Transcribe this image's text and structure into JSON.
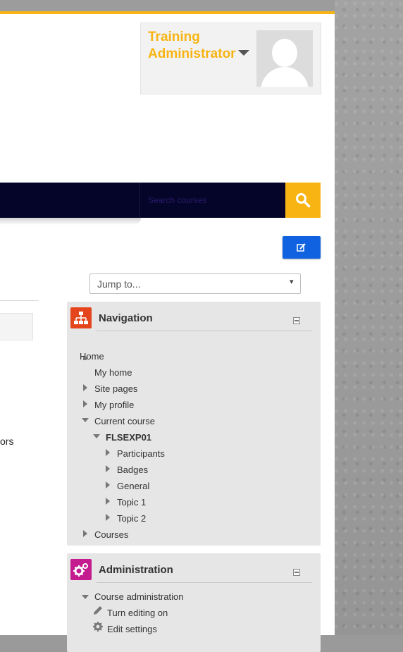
{
  "user": {
    "name_line1": "Training",
    "name_line2": "Administrator"
  },
  "search": {
    "placeholder": "Search courses"
  },
  "jump": {
    "label": "Jump to...",
    "arrow": "▾"
  },
  "left": {
    "partial_text": "ors"
  },
  "navigation": {
    "title": "Navigation",
    "items": {
      "home": "Home",
      "my_home": "My home",
      "site_pages": "Site pages",
      "my_profile": "My profile",
      "current_course": "Current course",
      "course_code": "FLSEXP01",
      "participants": "Participants",
      "badges": "Badges",
      "general": "General",
      "topic1": "Topic 1",
      "topic2": "Topic 2",
      "courses": "Courses"
    }
  },
  "administration": {
    "title": "Administration",
    "items": {
      "course_admin": "Course administration",
      "turn_editing_on": "Turn editing on",
      "edit_settings": "Edit settings"
    }
  },
  "colors": {
    "accent": "#f7b412",
    "navbar": "#05052a",
    "edit_button": "#1062e0",
    "nav_icon": "#e5451c",
    "admin_icon": "#c41c8f"
  },
  "icons": [
    "caret-down-icon",
    "search-icon",
    "edit-icon",
    "sitemap-icon",
    "cogs-icon",
    "pencil-icon",
    "gear-icon"
  ]
}
